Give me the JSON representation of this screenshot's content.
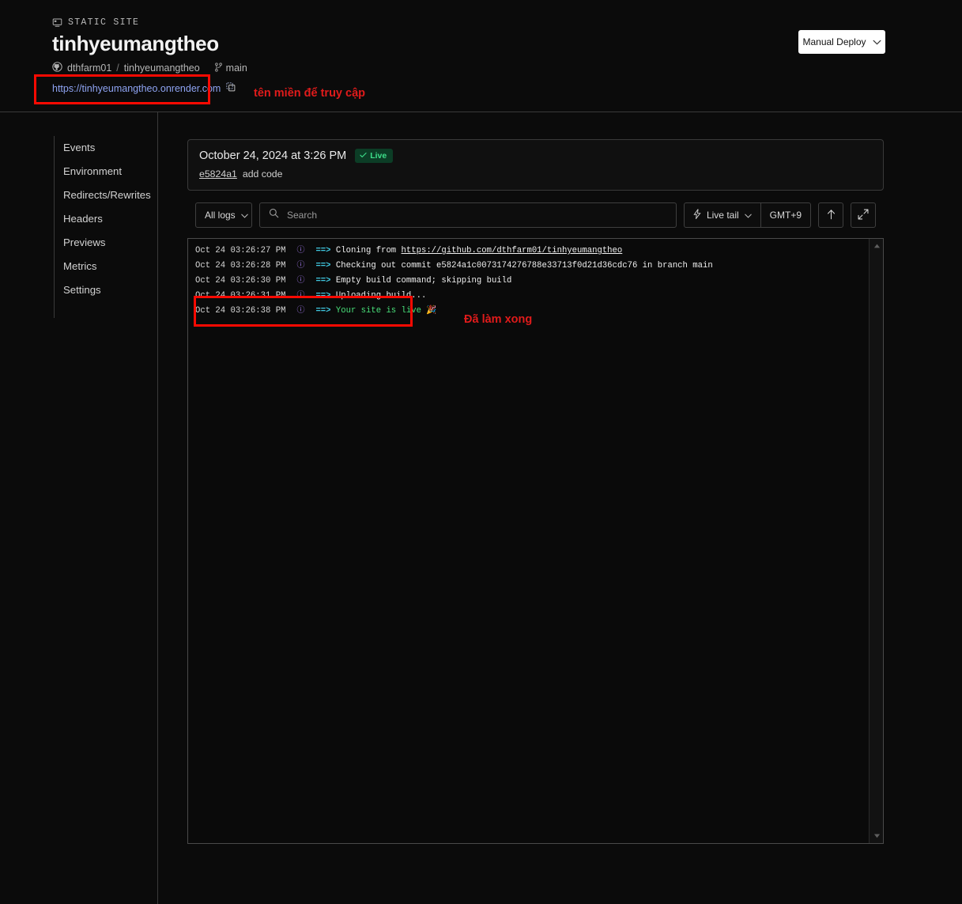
{
  "header": {
    "service_type": "STATIC SITE",
    "service_type_icon": "monitor-icon",
    "title": "tinhyeumangtheo",
    "repo_owner": "dthfarm01",
    "repo_separator": "/",
    "repo_name": "tinhyeumangtheo",
    "branch": "main",
    "url": "https://tinhyeumangtheo.onrender.com",
    "copy_icon": "copy-icon",
    "deploy_button": "Manual Deploy",
    "deploy_chevron_icon": "chevron-down-icon"
  },
  "annotations": {
    "url_note": "tên miền để truy cập",
    "log_note": "Đã làm xong",
    "color": "#e01b1b",
    "box_color": "#fb0a02"
  },
  "sidebar": {
    "items": [
      {
        "label": "Events"
      },
      {
        "label": "Environment"
      },
      {
        "label": "Redirects/Rewrites"
      },
      {
        "label": "Headers"
      },
      {
        "label": "Previews"
      },
      {
        "label": "Metrics"
      },
      {
        "label": "Settings"
      }
    ]
  },
  "deploy": {
    "date": "October 24, 2024 at 3:26 PM",
    "status_badge": "Live",
    "status_icon": "check-icon",
    "status_color": "#3ddf8a",
    "commit_hash_short": "e5824a1",
    "commit_message": "add code"
  },
  "toolbar": {
    "filter_label": "All logs",
    "filter_chevron_icon": "chevron-down-icon",
    "search_icon": "search-icon",
    "search_placeholder": "Search",
    "search_value": "",
    "live_tail_icon": "lightning-bolt-icon",
    "live_tail_label": "Live tail",
    "live_tail_chevron_icon": "chevron-down-icon",
    "timezone_label": "GMT+9",
    "scroll_top_icon": "arrow-up-icon",
    "expand_icon": "expand-diagonal-icon"
  },
  "logs": {
    "scroll_up_icon": "triangle-up-icon",
    "scroll_down_icon": "triangle-down-icon",
    "lines": [
      {
        "timestamp": "Oct 24 03:26:27 PM",
        "level_icon": "info-icon",
        "arrow": "==>",
        "message": "Cloning from ",
        "link": "https://github.com/dthfarm01/tinhyeumangtheo",
        "tail": "",
        "highlight": false
      },
      {
        "timestamp": "Oct 24 03:26:28 PM",
        "level_icon": "info-icon",
        "arrow": "==>",
        "message": "Checking out commit e5824a1c0073174276788e33713f0d21d36cdc76 in branch main",
        "link": "",
        "tail": "",
        "highlight": false
      },
      {
        "timestamp": "Oct 24 03:26:30 PM",
        "level_icon": "info-icon",
        "arrow": "==>",
        "message": "Empty build command; skipping build",
        "link": "",
        "tail": "",
        "highlight": false
      },
      {
        "timestamp": "Oct 24 03:26:31 PM",
        "level_icon": "info-icon",
        "arrow": "==>",
        "message": "Uploading build...",
        "link": "",
        "tail": "",
        "highlight": false
      },
      {
        "timestamp": "Oct 24 03:26:38 PM",
        "level_icon": "info-icon",
        "arrow": "==>",
        "message": "Your site is live 🎉",
        "link": "",
        "tail": "",
        "highlight": true
      }
    ]
  }
}
